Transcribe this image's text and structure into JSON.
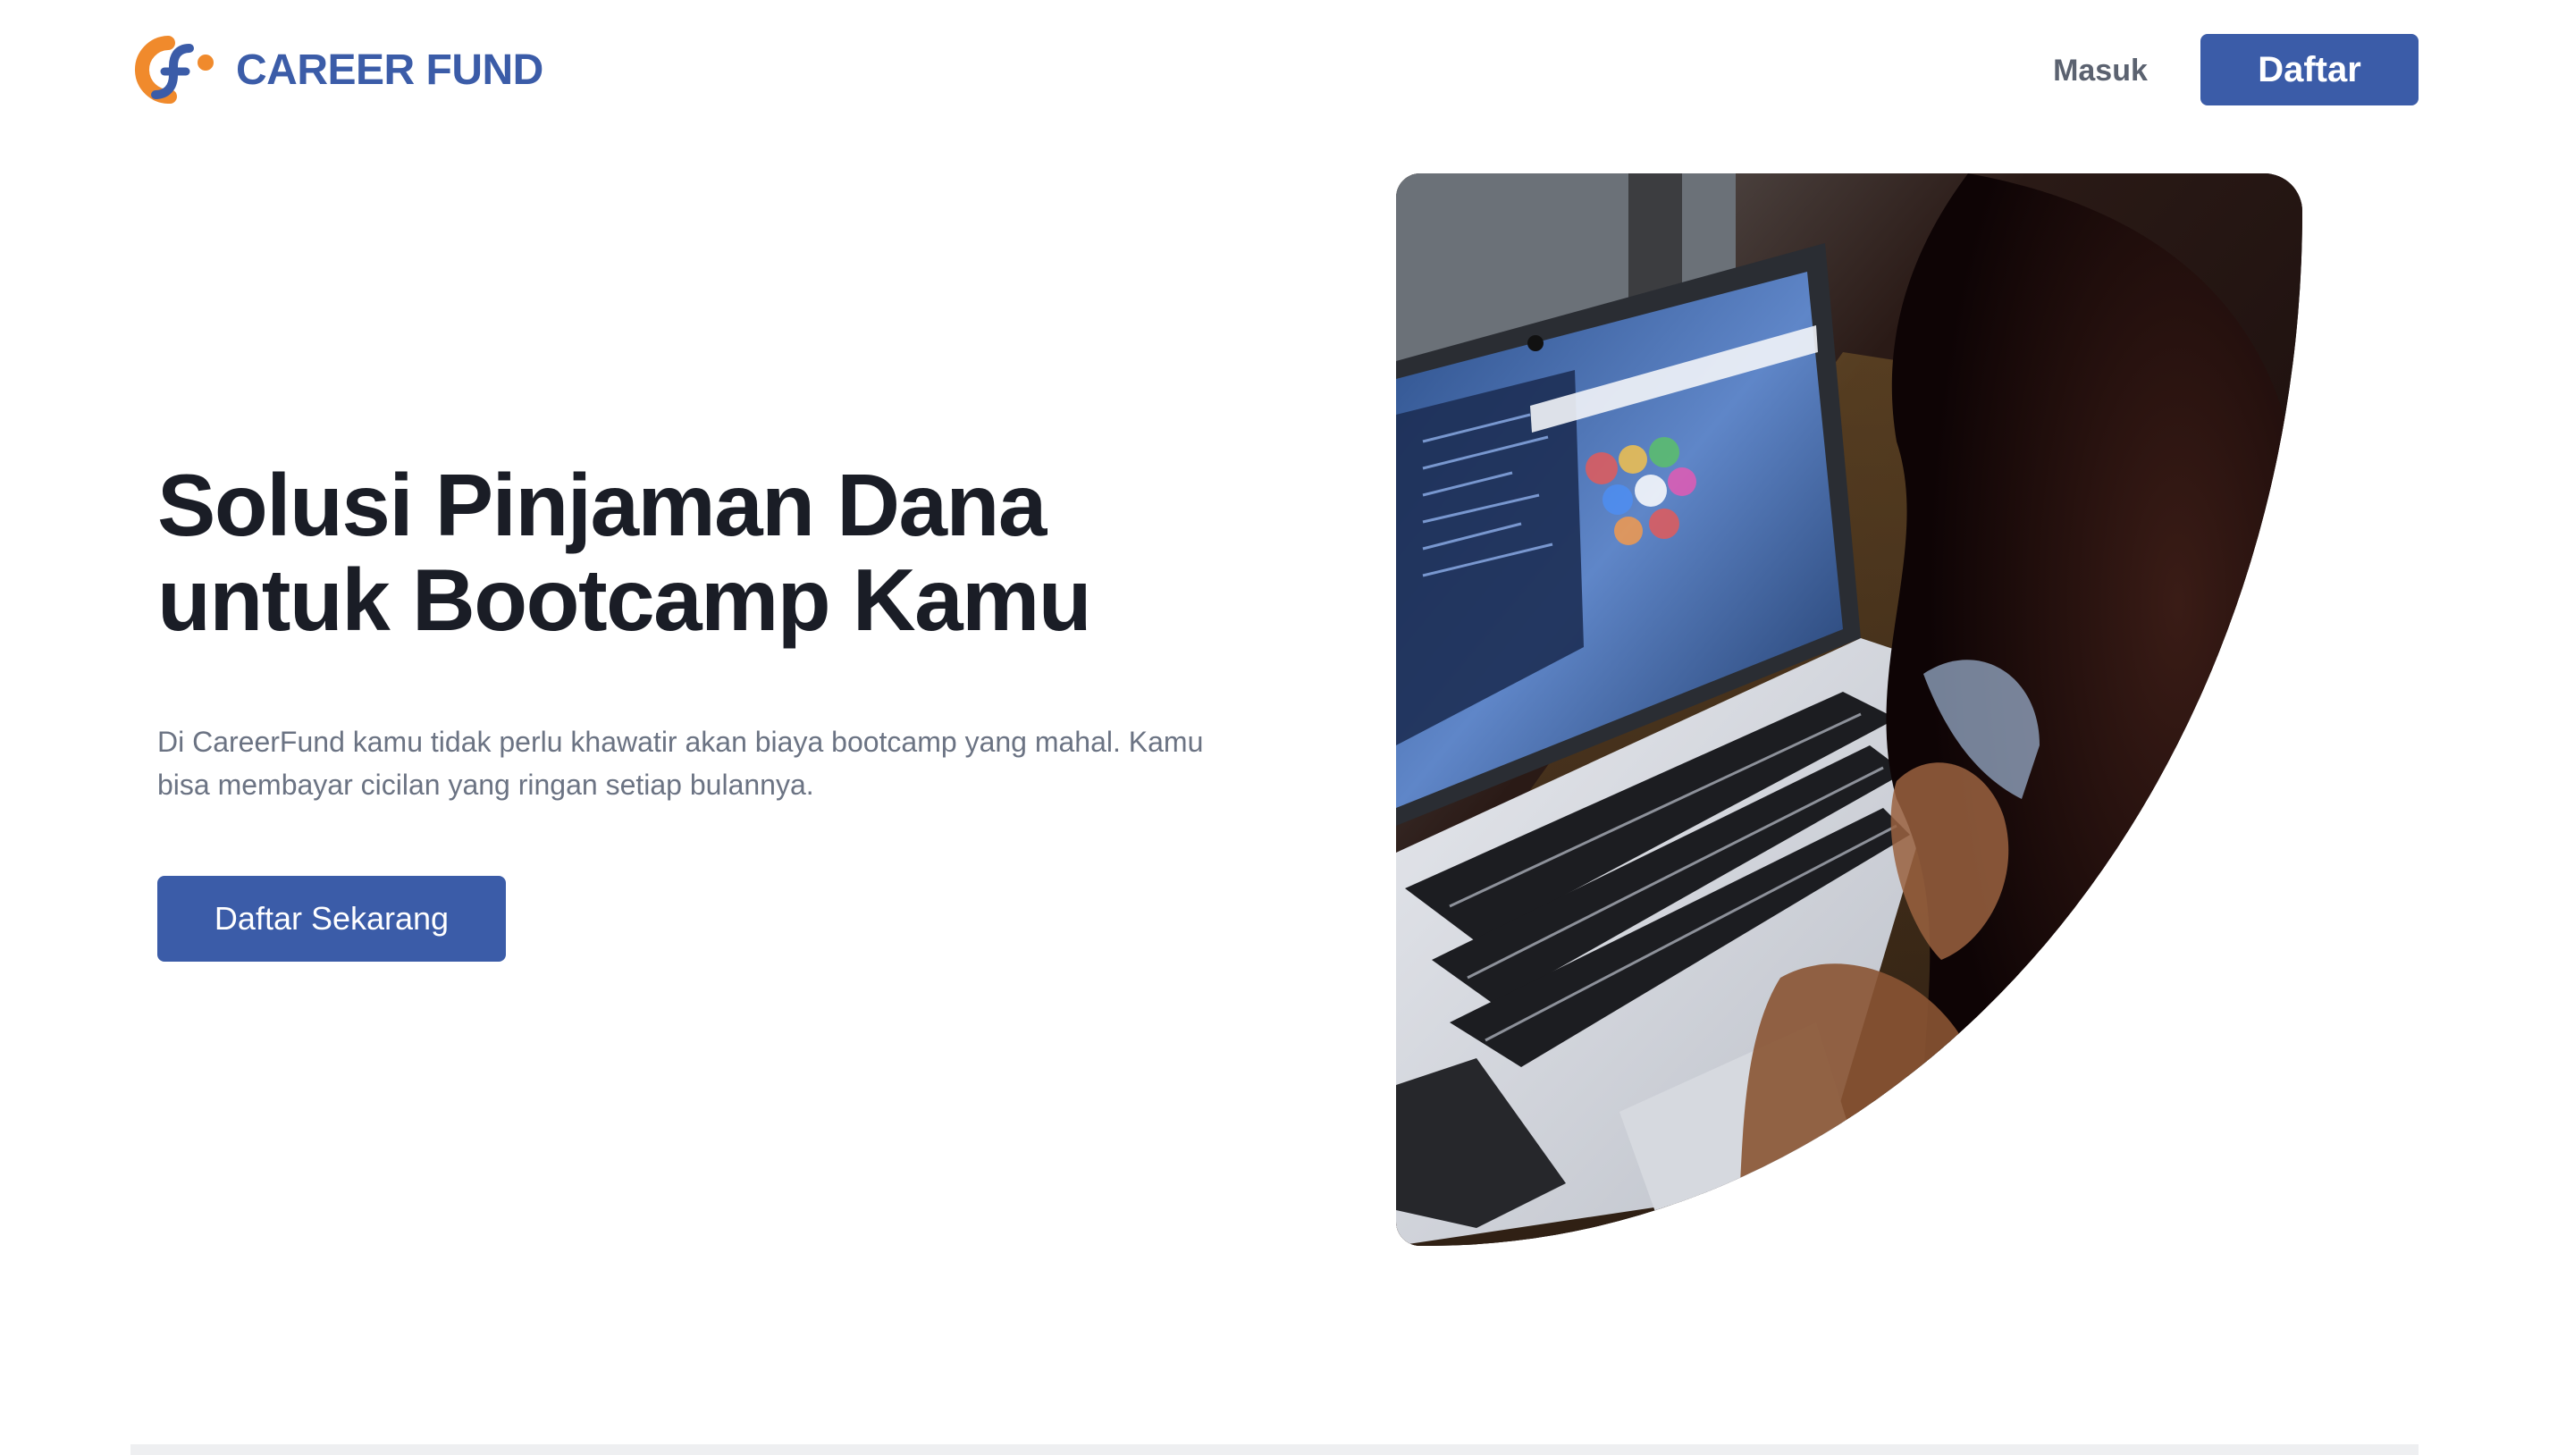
{
  "brand": {
    "name": "CAREER FUND",
    "logo_icon": "careerfund-logo-mark",
    "primary_color": "#3b5ca8",
    "accent_color": "#f08a2c"
  },
  "nav": {
    "login_label": "Masuk",
    "register_label": "Daftar"
  },
  "hero": {
    "title_line1": "Solusi Pinjaman Dana",
    "title_line2": "untuk Bootcamp Kamu",
    "description": "Di CareerFund kamu tidak perlu khawatir akan biaya bootcamp yang mahal. Kamu bisa membayar cicilan yang ringan setiap bulannya.",
    "cta_label": "Daftar Sekarang"
  }
}
